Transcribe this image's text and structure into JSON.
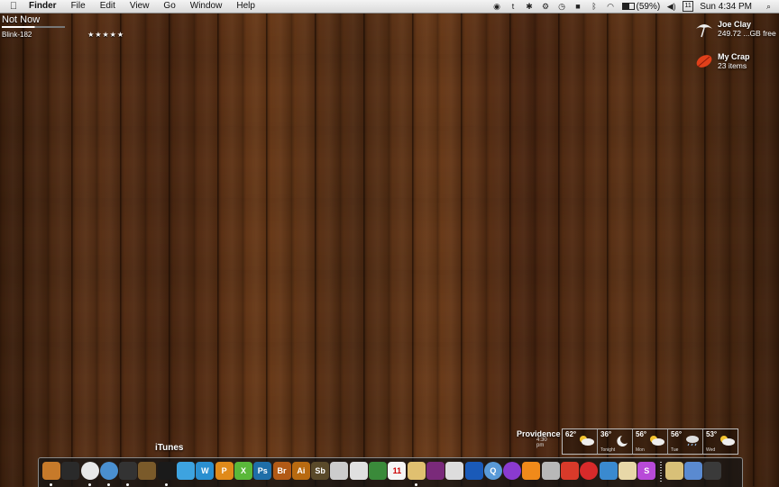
{
  "menubar": {
    "apple": "",
    "items": [
      "Finder",
      "File",
      "Edit",
      "View",
      "Go",
      "Window",
      "Help"
    ],
    "battery": "(59%)",
    "calendar_date": "11",
    "clock": "Sun 4:34 PM",
    "status_icons": [
      "gamepad-icon",
      "twitter-icon",
      "bulb-icon",
      "gear-icon",
      "time-machine-icon",
      "dropbox-icon",
      "bluetooth-icon",
      "wifi-icon",
      "battery-icon",
      "volume-icon",
      "calendar-icon",
      "spotlight-icon"
    ]
  },
  "now_playing": {
    "song": "Not Now",
    "artist": "Blink-182",
    "rating": "★★★★★",
    "progress": 0.52
  },
  "desktop": [
    {
      "name": "Joe Clay",
      "detail": "249.72 ...GB free",
      "icon": "umbrella-drive-icon"
    },
    {
      "name": "My Crap",
      "detail": "23 items",
      "icon": "red-leaf-folder-icon"
    }
  ],
  "weather": {
    "city": "Providence",
    "time": "4:30 pm",
    "days": [
      {
        "temp": "62°",
        "day": "",
        "icon": "partly-cloudy-icon"
      },
      {
        "temp": "36°",
        "day": "Tonight",
        "icon": "moon-icon"
      },
      {
        "temp": "56°",
        "day": "Mon",
        "icon": "partly-cloudy-icon"
      },
      {
        "temp": "56°",
        "day": "Tue",
        "icon": "rain-icon"
      },
      {
        "temp": "53°",
        "day": "Wed",
        "icon": "partly-cloudy-icon"
      }
    ]
  },
  "dock": {
    "hover_label": "iTunes",
    "items": [
      {
        "name": "finder",
        "color": "#c77a2a",
        "text": "",
        "running": true
      },
      {
        "name": "dashboard",
        "color": "#2a2a2a",
        "text": "",
        "running": false
      },
      {
        "name": "clock",
        "color": "#e8e8e8",
        "text": "",
        "running": true
      },
      {
        "name": "safari",
        "color": "#4a8fd0",
        "text": "",
        "running": true
      },
      {
        "name": "facetime",
        "color": "#333",
        "text": "",
        "running": true
      },
      {
        "name": "itunes",
        "color": "#7a5a2a",
        "text": "",
        "running": false
      },
      {
        "name": "terminal",
        "color": "#1a1a1a",
        "text": "",
        "running": true
      },
      {
        "name": "twitter",
        "color": "#3da3e0",
        "text": "",
        "running": false
      },
      {
        "name": "wordpress",
        "color": "#2a8fd0",
        "text": "W",
        "running": false
      },
      {
        "name": "pages",
        "color": "#e08a1a",
        "text": "P",
        "running": false
      },
      {
        "name": "xcode",
        "color": "#5ab83a",
        "text": "X",
        "running": false
      },
      {
        "name": "photoshop",
        "color": "#1f6ea8",
        "text": "Ps",
        "running": false
      },
      {
        "name": "bridge",
        "color": "#b25a16",
        "text": "Br",
        "running": false
      },
      {
        "name": "illustrator",
        "color": "#b86a10",
        "text": "Ai",
        "running": false
      },
      {
        "name": "soundbooth",
        "color": "#5a4a2a",
        "text": "Sb",
        "running": false
      },
      {
        "name": "automator",
        "color": "#cccccc",
        "text": "",
        "running": false
      },
      {
        "name": "mail",
        "color": "#e0e0e0",
        "text": "",
        "running": false
      },
      {
        "name": "preview",
        "color": "#3a8a3a",
        "text": "",
        "running": false
      },
      {
        "name": "calendar",
        "color": "#f5f5f5",
        "text": "11",
        "running": false
      },
      {
        "name": "notes",
        "color": "#e0c070",
        "text": "",
        "running": true
      },
      {
        "name": "photo",
        "color": "#7a2a7a",
        "text": "",
        "running": false
      },
      {
        "name": "piano",
        "color": "#ddd",
        "text": "",
        "running": false
      },
      {
        "name": "cube",
        "color": "#1a5ab8",
        "text": "",
        "running": false
      },
      {
        "name": "quicksilver",
        "color": "#5a9ad8",
        "text": "Q",
        "running": false
      },
      {
        "name": "orb",
        "color": "#8a3ad0",
        "text": "",
        "running": false
      },
      {
        "name": "vlc",
        "color": "#f08a1a",
        "text": "",
        "running": false
      },
      {
        "name": "dictionary",
        "color": "#b8b8b8",
        "text": "",
        "running": false
      },
      {
        "name": "paintbrush",
        "color": "#d83a2a",
        "text": "",
        "running": false
      },
      {
        "name": "lifesaver",
        "color": "#d82a2a",
        "text": "",
        "running": false
      },
      {
        "name": "twitterrific",
        "color": "#3a8ad0",
        "text": "",
        "running": false
      },
      {
        "name": "textedit",
        "color": "#e8d8a8",
        "text": "",
        "running": false
      },
      {
        "name": "skype",
        "color": "#b84ad8",
        "text": "S",
        "running": false
      },
      {
        "name": "documents",
        "color": "#d8c078",
        "text": "",
        "running": false
      },
      {
        "name": "downloads",
        "color": "#5a8ad0",
        "text": "",
        "running": false
      },
      {
        "name": "trash",
        "color": "#3a3a3a",
        "text": "",
        "running": false
      }
    ]
  },
  "colors": {
    "menubar": "#e6e6e6",
    "wood": "#5a3116",
    "text_light": "#ffffff"
  }
}
